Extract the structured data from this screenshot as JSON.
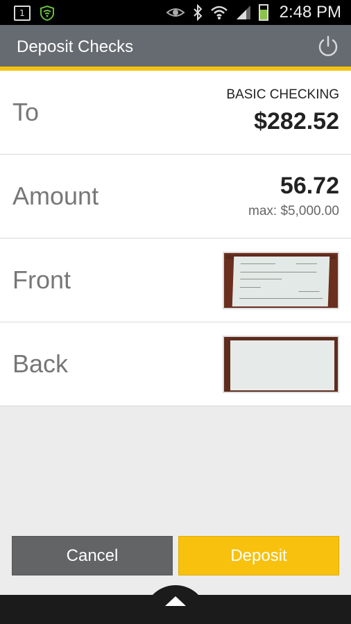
{
  "status_bar": {
    "notification_icons": [
      "sim-card-icon",
      "wifi-shield-icon"
    ],
    "status_icons": [
      "eye-icon",
      "bluetooth-icon",
      "wifi-icon",
      "signal-icon",
      "battery-icon"
    ],
    "sim_label": "1",
    "time": "2:48 PM"
  },
  "header": {
    "title": "Deposit Checks",
    "power_icon": "power-icon",
    "accent_color": "#f5c311",
    "bar_color": "#656b70"
  },
  "rows": {
    "to": {
      "label": "To",
      "account_name": "BASIC CHECKING",
      "balance": "$282.52"
    },
    "amount": {
      "label": "Amount",
      "value": "56.72",
      "max": "max: $5,000.00"
    },
    "front": {
      "label": "Front",
      "thumbnail_icon": "check-front-image"
    },
    "back": {
      "label": "Back",
      "thumbnail_icon": "check-back-image"
    }
  },
  "buttons": {
    "cancel": "Cancel",
    "deposit": "Deposit",
    "deposit_color": "#f7c10e",
    "cancel_color": "#636466"
  },
  "nav": {
    "handle_icon": "chevron-up-icon"
  }
}
